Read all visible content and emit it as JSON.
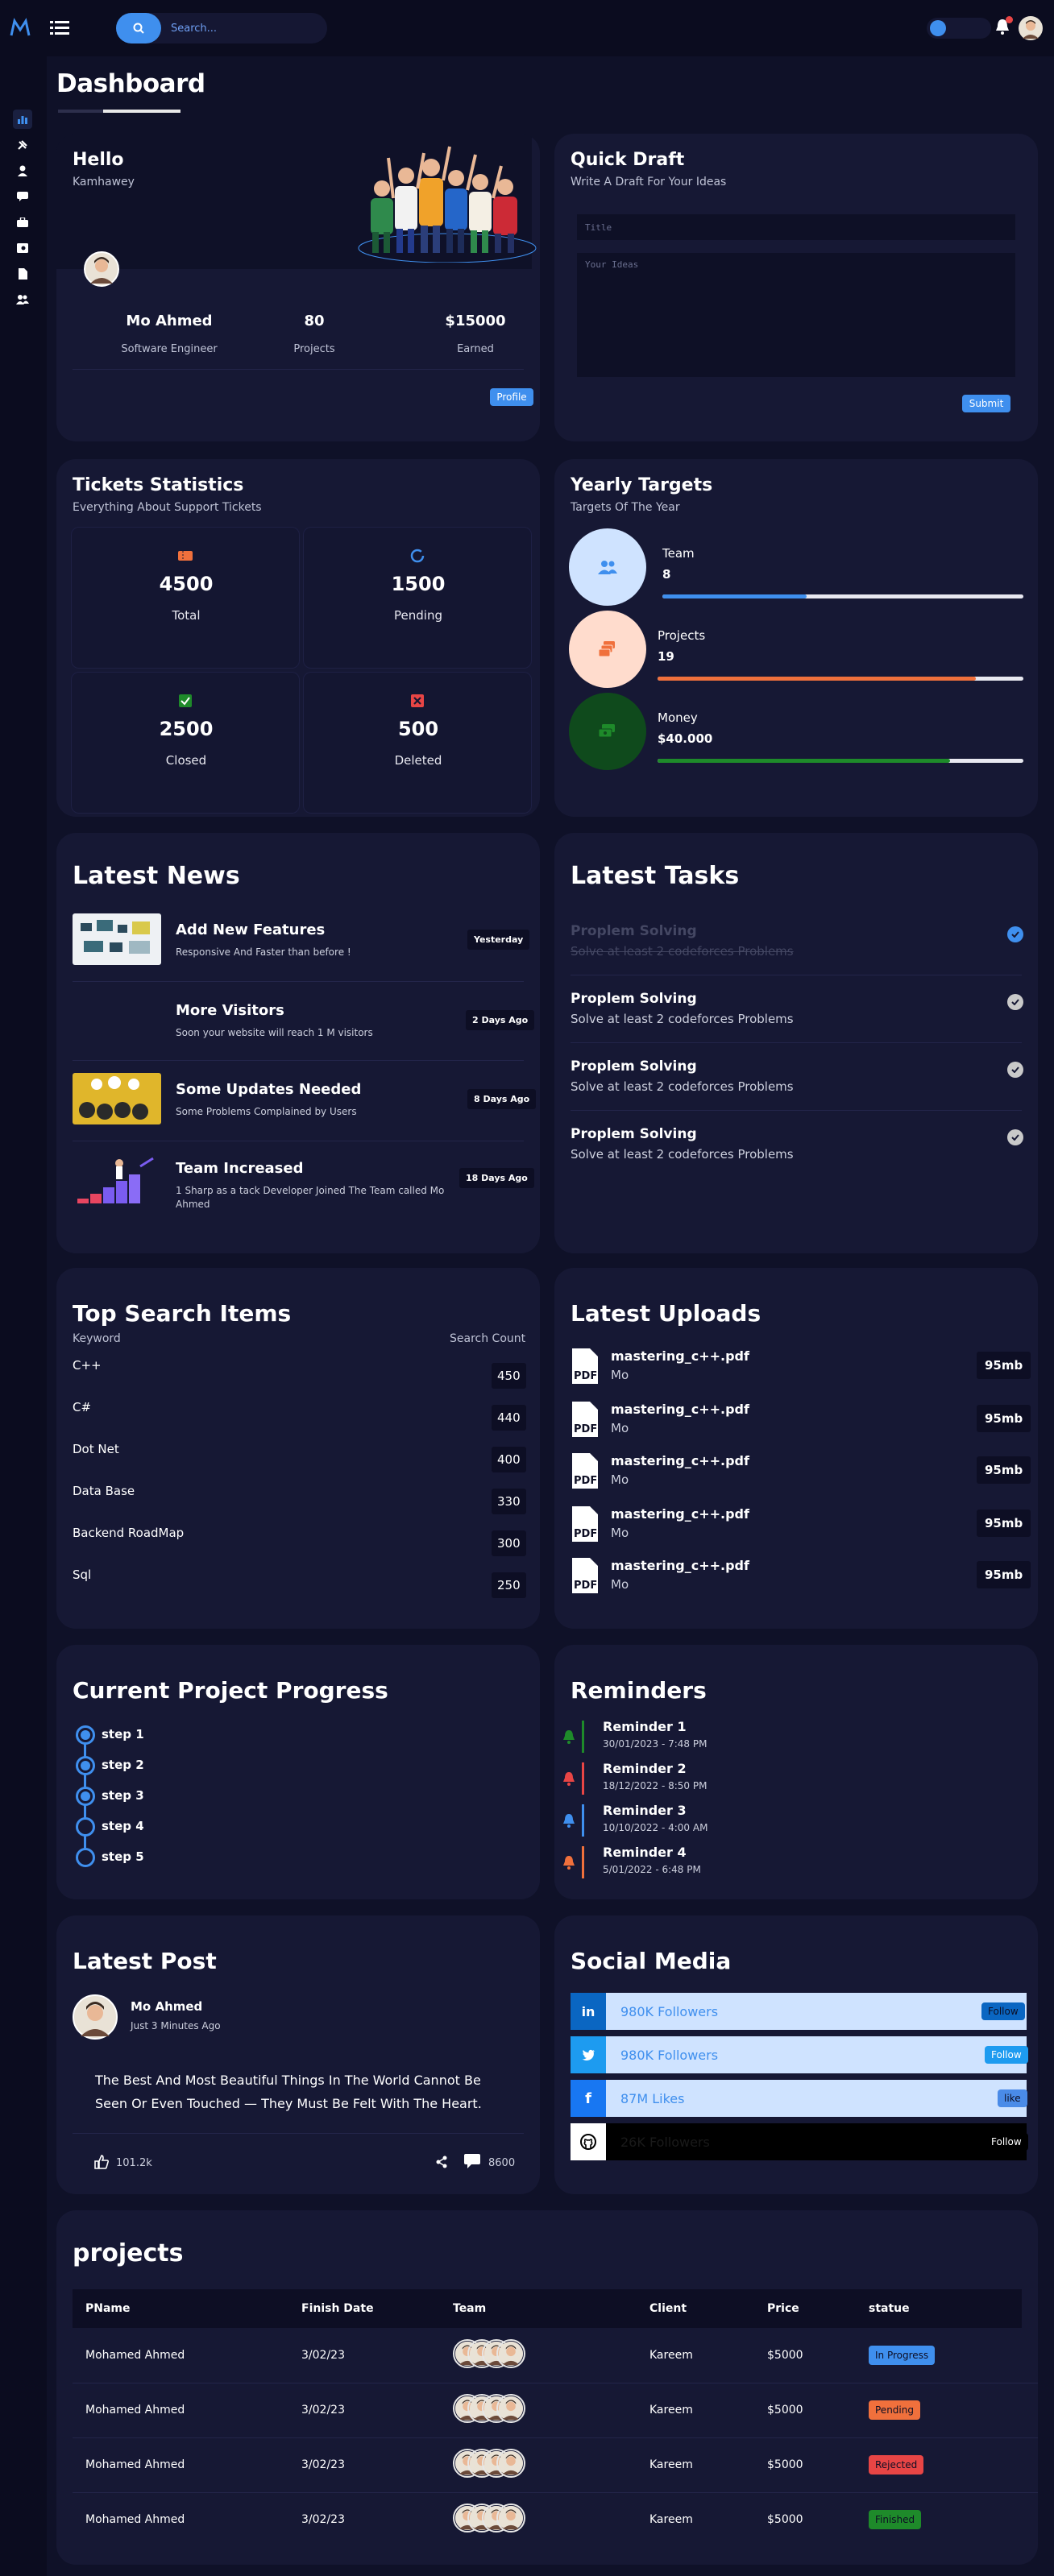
{
  "search": {
    "placeholder": "Search..."
  },
  "page": {
    "title": "Dashboard"
  },
  "colors": {
    "accent": "#3f8fee",
    "card": "#161834",
    "background": "#0d0e24",
    "orange": "#f0703c",
    "green": "#1e8a2a",
    "red": "#e84545"
  },
  "sidebar": {
    "items": [
      {
        "icon": "chart-icon"
      },
      {
        "icon": "settings-icon"
      },
      {
        "icon": "user-icon"
      },
      {
        "icon": "chat-icon"
      },
      {
        "icon": "briefcase-icon"
      },
      {
        "icon": "image-icon"
      },
      {
        "icon": "document-icon"
      },
      {
        "icon": "users-icon"
      }
    ]
  },
  "welcome": {
    "title": "Hello",
    "subtitle": "Kamhawey",
    "name": "Mo Ahmed",
    "role": "Software Engineer",
    "projects_value": "80",
    "projects_label": "Projects",
    "earned_value": "$15000",
    "earned_label": "Earned",
    "profile_button": "Profile"
  },
  "draft": {
    "title": "Quick Draft",
    "subtitle": "Write A Draft For Your Ideas",
    "title_placeholder": "Title",
    "ideas_placeholder": "Your Ideas",
    "submit": "Submit"
  },
  "tickets": {
    "title": "Tickets Statistics",
    "subtitle": "Everything About Support Tickets",
    "items": [
      {
        "value": "4500",
        "label": "Total",
        "icon": "ticket-icon"
      },
      {
        "value": "1500",
        "label": "Pending",
        "icon": "spinner-icon"
      },
      {
        "value": "2500",
        "label": "Closed",
        "icon": "check-square-icon"
      },
      {
        "value": "500",
        "label": "Deleted",
        "icon": "x-square-icon"
      }
    ]
  },
  "targets": {
    "title": "Yearly Targets",
    "subtitle": "Targets Of The Year",
    "items": [
      {
        "name": "Team",
        "value": "8",
        "progress": 0.4,
        "color": "#3f8fee"
      },
      {
        "name": "Projects",
        "value": "19",
        "progress": 0.87,
        "color": "#f0703c"
      },
      {
        "name": "Money",
        "value": "$40.000",
        "progress": 0.8,
        "color": "#1e8a2a"
      }
    ]
  },
  "news": {
    "title": "Latest News",
    "items": [
      {
        "title": "Add New Features",
        "desc": "Responsive And Faster than before !",
        "date": "Yesterday"
      },
      {
        "title": "More Visitors",
        "desc": "Soon your website will reach 1 M visitors",
        "date": "2 Days Ago"
      },
      {
        "title": "Some Updates Needed",
        "desc": "Some Problems Complained by Users",
        "date": "8 Days Ago"
      },
      {
        "title": "Team Increased",
        "desc": "1 Sharp as a tack Developer Joined The Team called Mo Ahmed",
        "date": "18 Days Ago"
      }
    ]
  },
  "tasks": {
    "title": "Latest Tasks",
    "items": [
      {
        "title": "Proplem Solving",
        "desc": "Solve at least 2 codeforces Problems",
        "done": true
      },
      {
        "title": "Proplem Solving",
        "desc": "Solve at least 2 codeforces Problems",
        "done": false
      },
      {
        "title": "Proplem Solving",
        "desc": "Solve at least 2 codeforces Problems",
        "done": false
      },
      {
        "title": "Proplem Solving",
        "desc": "Solve at least 2 codeforces Problems",
        "done": false
      }
    ]
  },
  "search_items": {
    "title": "Top Search Items",
    "col_keyword": "Keyword",
    "col_count": "Search Count",
    "rows": [
      {
        "keyword": "C++",
        "count": "450"
      },
      {
        "keyword": "C#",
        "count": "440"
      },
      {
        "keyword": "Dot Net",
        "count": "400"
      },
      {
        "keyword": "Data Base",
        "count": "330"
      },
      {
        "keyword": "Backend RoadMap",
        "count": "300"
      },
      {
        "keyword": "Sql",
        "count": "250"
      }
    ]
  },
  "uploads": {
    "title": "Latest Uploads",
    "items": [
      {
        "name": "mastering_c++.pdf",
        "by": "Mo",
        "size": "95mb"
      },
      {
        "name": "mastering_c++.pdf",
        "by": "Mo",
        "size": "95mb"
      },
      {
        "name": "mastering_c++.pdf",
        "by": "Mo",
        "size": "95mb"
      },
      {
        "name": "mastering_c++.pdf",
        "by": "Mo",
        "size": "95mb"
      },
      {
        "name": "mastering_c++.pdf",
        "by": "Mo",
        "size": "95mb"
      }
    ]
  },
  "progress": {
    "title": "Current Project Progress",
    "completed_steps": 3,
    "steps": [
      "step 1",
      "step 2",
      "step 3",
      "step 4",
      "step 5"
    ]
  },
  "reminders": {
    "title": "Reminders",
    "items": [
      {
        "title": "Reminder 1",
        "date": "30/01/2023 - 7:48 PM",
        "color": "#1e8a2a"
      },
      {
        "title": "Reminder 2",
        "date": "18/12/2022 - 8:50 PM",
        "color": "#e84545"
      },
      {
        "title": "Reminder 3",
        "date": "10/10/2022 - 4:00 AM",
        "color": "#3f8fee"
      },
      {
        "title": "Reminder 4",
        "date": "5/01/2022 - 6:48 PM",
        "color": "#f0703c"
      }
    ]
  },
  "post": {
    "title": "Latest Post",
    "author": "Mo Ahmed",
    "time": "Just 3 Minutes Ago",
    "text": "The Best And Most Beautiful Things In The World Cannot Be Seen Or Even Touched — They Must Be Felt With The Heart.",
    "likes": "101.2k",
    "comments": "8600"
  },
  "social": {
    "title": "Social Media",
    "items": [
      {
        "icon": "linkedin-icon",
        "glyph": "in",
        "count": "980K Followers",
        "button": "Follow",
        "icon_bg": "#0a66c2",
        "row_bg": "#cfe3ff",
        "text_color": "#3f8fee",
        "btn_bg": "#0a66c2",
        "btn_color": "#0d0e24"
      },
      {
        "icon": "twitter-icon",
        "glyph": "✦",
        "count": "980K Followers",
        "button": "Follow",
        "icon_bg": "#1d9bf0",
        "row_bg": "#cfe3ff",
        "text_color": "#3f8fee",
        "btn_bg": "#1d9bf0",
        "btn_color": "#ffffff"
      },
      {
        "icon": "facebook-icon",
        "glyph": "f",
        "count": "87M Likes",
        "button": "like",
        "icon_bg": "#1877f2",
        "row_bg": "#cfe3ff",
        "text_color": "#3f8fee",
        "btn_bg": "#4a8be8",
        "btn_color": "#0d0e24"
      },
      {
        "icon": "github-icon",
        "glyph": "●",
        "count": "26K Followers",
        "button": "Follow",
        "icon_bg": "#ffffff",
        "row_bg": "#000000",
        "text_color": "#1a1a1a",
        "btn_bg": "#000000",
        "btn_color": "#ffffff"
      }
    ]
  },
  "projects": {
    "title": "projects",
    "headers": [
      "PName",
      "Finish Date",
      "Team",
      "Client",
      "Price",
      "statue"
    ],
    "rows": [
      {
        "name": "Mohamed Ahmed",
        "date": "3/02/23",
        "client": "Kareem",
        "price": "$5000",
        "status": "In Progress",
        "status_bg": "#3f8fee",
        "status_color": "#0d0e24"
      },
      {
        "name": "Mohamed Ahmed",
        "date": "3/02/23",
        "client": "Kareem",
        "price": "$5000",
        "status": "Pending",
        "status_bg": "#f0703c",
        "status_color": "#0d0e24"
      },
      {
        "name": "Mohamed Ahmed",
        "date": "3/02/23",
        "client": "Kareem",
        "price": "$5000",
        "status": "Rejected",
        "status_bg": "#e84545",
        "status_color": "#0d0e24"
      },
      {
        "name": "Mohamed Ahmed",
        "date": "3/02/23",
        "client": "Kareem",
        "price": "$5000",
        "status": "Finished",
        "status_bg": "#1e8a2a",
        "status_color": "#0d0e24"
      }
    ]
  }
}
